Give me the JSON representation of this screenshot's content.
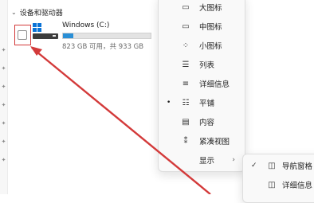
{
  "group": {
    "title": "设备和驱动器"
  },
  "drive": {
    "name": "Windows (C:)",
    "space_info": "823 GB 可用，共 933 GB",
    "used_fraction": 0.12
  },
  "menu": {
    "items": [
      {
        "label": "大图标",
        "icon": "monitor-icon",
        "glyph": "▭"
      },
      {
        "label": "中图标",
        "icon": "monitor-icon",
        "glyph": "▭"
      },
      {
        "label": "小图标",
        "icon": "grid-icon",
        "glyph": "⁘"
      },
      {
        "label": "列表",
        "icon": "list-icon",
        "glyph": "☰"
      },
      {
        "label": "详细信息",
        "icon": "details-icon",
        "glyph": "≡"
      },
      {
        "label": "平铺",
        "icon": "tiles-icon",
        "glyph": "☷",
        "selected": true
      },
      {
        "label": "内容",
        "icon": "content-icon",
        "glyph": "▤"
      },
      {
        "label": "紧凑视图",
        "icon": "compact-icon",
        "glyph": "⁑"
      },
      {
        "label": "显示",
        "has_submenu": true
      }
    ]
  },
  "submenu": {
    "items": [
      {
        "label": "导航窗格",
        "checked": true,
        "icon": "pane-icon",
        "glyph": "◫"
      },
      {
        "label": "详细信息",
        "checked": false,
        "icon": "pane-icon",
        "glyph": "◫"
      }
    ]
  },
  "colors": {
    "accent": "#0b73d6",
    "drive_bar": "#2a8fd6",
    "annotation_red": "#d33a3a"
  }
}
